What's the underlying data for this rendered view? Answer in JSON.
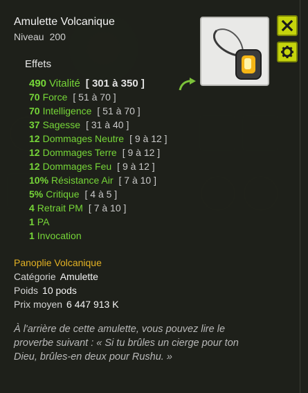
{
  "item": {
    "name": "Amulette Volcanique",
    "level_label": "Niveau",
    "level_value": "200"
  },
  "effects_header": "Effets",
  "effects": [
    {
      "value": "490",
      "name": "Vitalité",
      "range": "[ 301 à 350 ]",
      "main": true
    },
    {
      "value": "70",
      "name": "Force",
      "range": "[ 51 à 70 ]"
    },
    {
      "value": "70",
      "name": "Intelligence",
      "range": "[ 51 à 70 ]"
    },
    {
      "value": "37",
      "name": "Sagesse",
      "range": "[ 31 à 40 ]"
    },
    {
      "value": "12",
      "name": "Dommages Neutre",
      "range": "[ 9 à 12 ]"
    },
    {
      "value": "12",
      "name": "Dommages Terre",
      "range": "[ 9 à 12 ]"
    },
    {
      "value": "12",
      "name": "Dommages Feu",
      "range": "[ 9 à 12 ]"
    },
    {
      "value": "10%",
      "name": "Résistance Air",
      "range": "[ 7 à 10 ]"
    },
    {
      "value": "5%",
      "name": "Critique",
      "range": "[ 4 à 5 ]"
    },
    {
      "value": "4",
      "name": "Retrait PM",
      "range": "[ 7 à 10 ]"
    },
    {
      "value": "1",
      "name": "PA",
      "range": ""
    },
    {
      "value": "1",
      "name": "Invocation",
      "range": ""
    }
  ],
  "set": {
    "name": "Panoplie Volcanique"
  },
  "meta": {
    "category_label": "Catégorie",
    "category_value": "Amulette",
    "weight_label": "Poids",
    "weight_value": "10 pods",
    "price_label": "Prix moyen",
    "price_value": "6 447 913 K"
  },
  "lore": "À l'arrière de cette amulette, vous pouvez lire le proverbe suivant : « Si tu brûles un cierge pour ton Dieu, brûles-en deux pour Rushu. »",
  "icons": {
    "close": "close-icon",
    "settings": "gear-icon",
    "item": "amulet-icon",
    "compare": "curved-arrow-icon"
  },
  "colors": {
    "effect_green": "#76d638",
    "set_gold": "#e4b224",
    "button_yellow": "#c5d40c"
  }
}
